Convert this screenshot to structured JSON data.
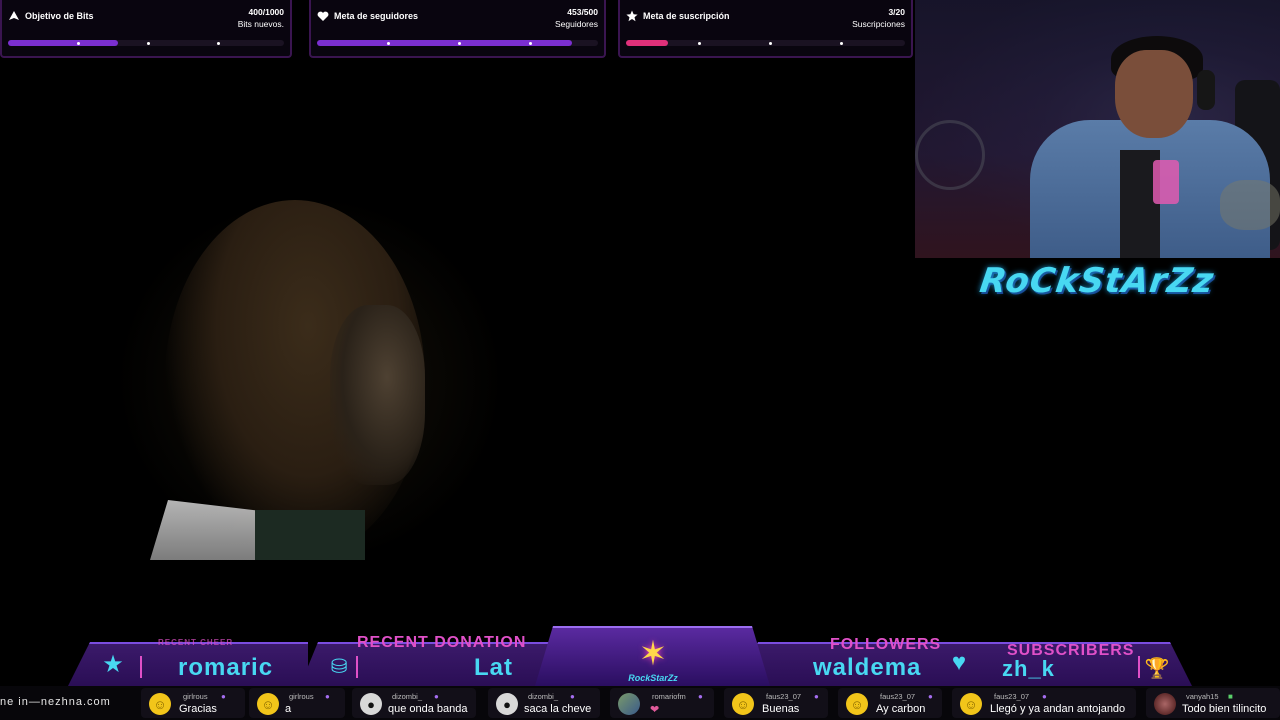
{
  "goals": [
    {
      "title": "Objetivo de Bits",
      "count": "400/1000",
      "sub": "Bits nuevos.",
      "icon": "bits-icon",
      "progress": 0.4,
      "fill_color": "#7b2fd0"
    },
    {
      "title": "Meta de seguidores",
      "count": "453/500",
      "sub": "Seguidores",
      "icon": "heart-icon",
      "progress": 0.906,
      "fill_color": "#7b2fd0"
    },
    {
      "title": "Meta de suscripción",
      "count": "3/20",
      "sub": "Suscripciones",
      "icon": "star-icon",
      "progress": 0.15,
      "fill_color": "#e0307a"
    }
  ],
  "logo_text": "RoCkStArZz",
  "alerts": {
    "recent_cheer": {
      "label": "RECENT CHEER",
      "value": "romaric"
    },
    "recent_donation": {
      "label": "RECENT DONATION",
      "value": "Lat"
    },
    "followers": {
      "label": "FOLLOWERS",
      "value": "waldema"
    },
    "subscribers": {
      "label": "SUBSCRIBERS",
      "value": "zh_k"
    },
    "badge_text": "RockStarZz"
  },
  "ticker": {
    "lead": "ne in—nezhna.com",
    "messages": [
      {
        "user": "girlrous",
        "text": "Gracias",
        "avatar": "smiley"
      },
      {
        "user": "girlrous",
        "text": "a",
        "avatar": "smiley"
      },
      {
        "user": "dizombi_",
        "text": "que onda banda",
        "avatar": "dark"
      },
      {
        "user": "dizombi_",
        "text": "saca la cheve",
        "avatar": "dark"
      },
      {
        "user": "romariofm",
        "text": "❤",
        "avatar": "img"
      },
      {
        "user": "faus23_07",
        "text": "Buenas",
        "avatar": "smiley"
      },
      {
        "user": "faus23_07",
        "text": "Ay carbon",
        "avatar": "smiley"
      },
      {
        "user": "faus23_07",
        "text": "Llegó y ya andan antojando",
        "avatar": "smiley"
      },
      {
        "user": "vanyah15",
        "text": "Todo bien tilincito",
        "avatar": "pic"
      }
    ]
  },
  "colors": {
    "accent_cyan": "#48d8f2",
    "accent_pink": "#e050c8",
    "panel_purple": "#2a0e55"
  }
}
